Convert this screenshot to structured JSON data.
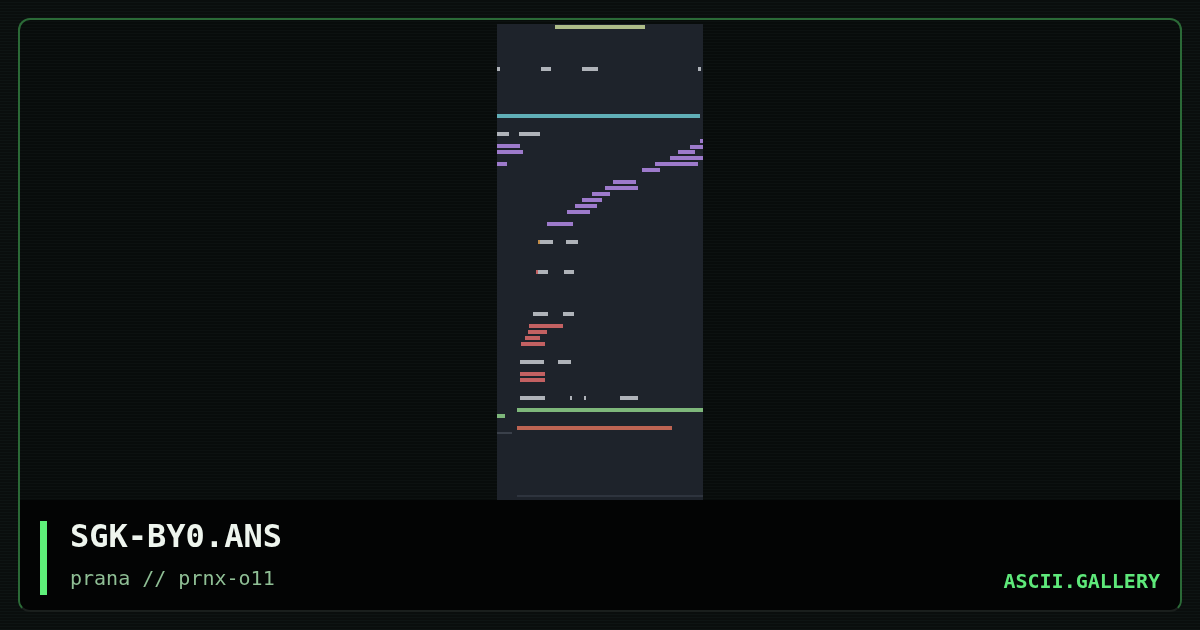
{
  "artwork": {
    "title": "SGK-BY0.ANS",
    "credit": "prana // prnx-o11"
  },
  "site": {
    "brand": "ASCII.GALLERY"
  }
}
